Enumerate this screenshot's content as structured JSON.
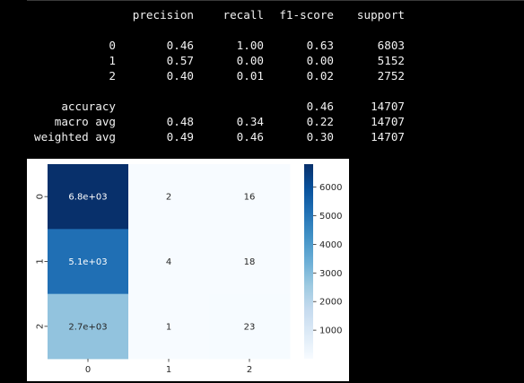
{
  "report": {
    "header": [
      "",
      "precision",
      "recall",
      "f1-score",
      "support"
    ],
    "rows": [
      {
        "label": "0",
        "precision": "0.46",
        "recall": "1.00",
        "f1": "0.63",
        "support": "6803"
      },
      {
        "label": "1",
        "precision": "0.57",
        "recall": "0.00",
        "f1": "0.00",
        "support": "5152"
      },
      {
        "label": "2",
        "precision": "0.40",
        "recall": "0.01",
        "f1": "0.02",
        "support": "2752"
      }
    ],
    "summary": [
      {
        "label": "accuracy",
        "precision": "",
        "recall": "",
        "f1": "0.46",
        "support": "14707"
      },
      {
        "label": "macro avg",
        "precision": "0.48",
        "recall": "0.34",
        "f1": "0.22",
        "support": "14707"
      },
      {
        "label": "weighted avg",
        "precision": "0.49",
        "recall": "0.46",
        "f1": "0.30",
        "support": "14707"
      }
    ]
  },
  "chart_data": {
    "type": "heatmap",
    "x_categories": [
      "0",
      "1",
      "2"
    ],
    "y_categories": [
      "0",
      "1",
      "2"
    ],
    "values": [
      [
        6803,
        2,
        16
      ],
      [
        5152,
        4,
        18
      ],
      [
        2752,
        1,
        23
      ]
    ],
    "annotations": [
      [
        "6.8e+03",
        "2",
        "16"
      ],
      [
        "5.1e+03",
        "4",
        "18"
      ],
      [
        "2.7e+03",
        "1",
        "23"
      ]
    ],
    "colormap": "Blues",
    "colorbar": {
      "range": [
        1,
        6803
      ],
      "ticks": [
        1000,
        2000,
        3000,
        4000,
        5000,
        6000
      ],
      "tick_labels": [
        "1000",
        "2000",
        "3000",
        "4000",
        "5000",
        "6000"
      ]
    },
    "colors": {
      "min": "#f7fbff",
      "max": "#08306b",
      "text_dark": "#262626",
      "text_light": "#ffffff"
    }
  }
}
